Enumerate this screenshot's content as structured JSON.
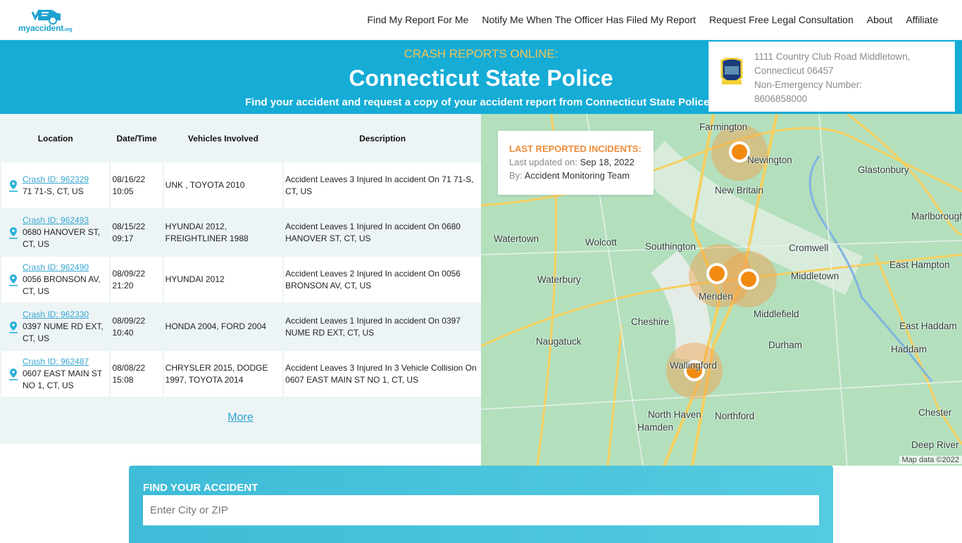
{
  "brand": {
    "logo_text": "myaccident",
    "logo_suffix": ".org"
  },
  "nav": {
    "items": [
      {
        "label": "Find My Report For Me"
      },
      {
        "label": "Notify Me When The Officer Has Filed My Report"
      },
      {
        "label": "Request Free Legal Consultation"
      },
      {
        "label": "About"
      },
      {
        "label": "Affiliate"
      }
    ]
  },
  "hero": {
    "kicker": "CRASH REPORTS ONLINE:",
    "title": "Connecticut State Police",
    "description": "Find your accident and request a copy of your accident report from Connecticut State Police"
  },
  "agency": {
    "badge_icon": "state-police-badge-icon",
    "address_line1": "1111 Country Club Road Middletown,",
    "address_line2": "Connecticut 06457",
    "phone_label": "Non-Emergency Number:",
    "phone": "8606858000"
  },
  "table": {
    "headers": [
      "Location",
      "Date/Time",
      "Vehicles Involved",
      "Description"
    ],
    "rows": [
      {
        "crash_id": "Crash ID: 962329",
        "address": "71 71-S, CT, US",
        "date": "08/16/22",
        "time": "10:05",
        "vehicles": "UNK , TOYOTA 2010",
        "description": "Accident Leaves 3 Injured In accident On 71 71-S, CT, US"
      },
      {
        "crash_id": "Crash ID: 962493",
        "address": "0680 HANOVER ST, CT, US",
        "date": "08/15/22",
        "time": "09:17",
        "vehicles": "HYUNDAI 2012, FREIGHTLINER 1988",
        "description": "Accident Leaves 1 Injured In accident On 0680 HANOVER ST, CT, US"
      },
      {
        "crash_id": "Crash ID: 962490",
        "address": "0056 BRONSON AV, CT, US",
        "date": "08/09/22",
        "time": "21:20",
        "vehicles": "HYUNDAI 2012",
        "description": "Accident Leaves 2 Injured In accident On 0056 BRONSON AV, CT, US"
      },
      {
        "crash_id": "Crash ID: 962330",
        "address": "0397 NUME RD EXT, CT, US",
        "date": "08/09/22",
        "time": "10:40",
        "vehicles": "HONDA 2004, FORD 2004",
        "description": "Accident Leaves 1 Injured In accident On 0397 NUME RD EXT, CT, US"
      },
      {
        "crash_id": "Crash ID: 962487",
        "address": "0607 EAST MAIN ST NO 1, CT, US",
        "date": "08/08/22",
        "time": "15:08",
        "vehicles": "CHRYSLER 2015, DODGE 1997, TOYOTA 2014",
        "description": "Accident Leaves 3 Injured In 3 Vehicle Collision On 0607 EAST MAIN ST NO 1, CT, US"
      }
    ],
    "more_label": "More"
  },
  "map": {
    "card_title": "LAST REPORTED INCIDENTS:",
    "updated_label": "Last updated on:",
    "updated_value": "Sep 18, 2022",
    "by_label": "By:",
    "by_value": "Accident Monitoring Team",
    "attribution": "Map data ©2022",
    "places": [
      "Farmington",
      "Newington",
      "Glastonbury",
      "New Britain",
      "Marlborough",
      "Watertown",
      "Wolcott",
      "Southington",
      "Cromwell",
      "East Hampton",
      "Waterbury",
      "Meriden",
      "Middletown",
      "Middlefield",
      "Cheshire",
      "East Haddam",
      "Naugatuck",
      "Durham",
      "Haddam",
      "Wallingford",
      "Chester",
      "North Haven",
      "Northford",
      "Hamden",
      "Deep River"
    ]
  },
  "search": {
    "label": "FIND YOUR ACCIDENT",
    "placeholder": "Enter City or ZIP",
    "value": ""
  }
}
